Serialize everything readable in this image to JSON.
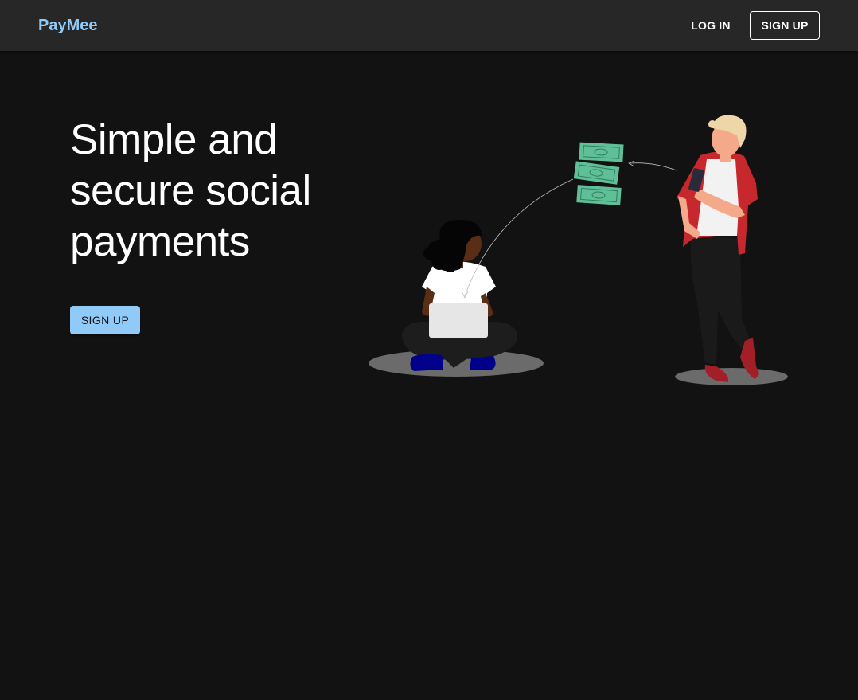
{
  "appbar": {
    "brand": "PayMee",
    "login_label": "LOG IN",
    "signup_label": "SIGN UP"
  },
  "hero": {
    "title": "Simple and secure social payments",
    "signup_label": "SIGN UP",
    "illustration": "money-transfer-illustration"
  },
  "colors": {
    "background": "#121212",
    "appbar": "#272727",
    "accent": "#90caf9",
    "money": "#5fbf98",
    "jacket": "#c6282e"
  }
}
